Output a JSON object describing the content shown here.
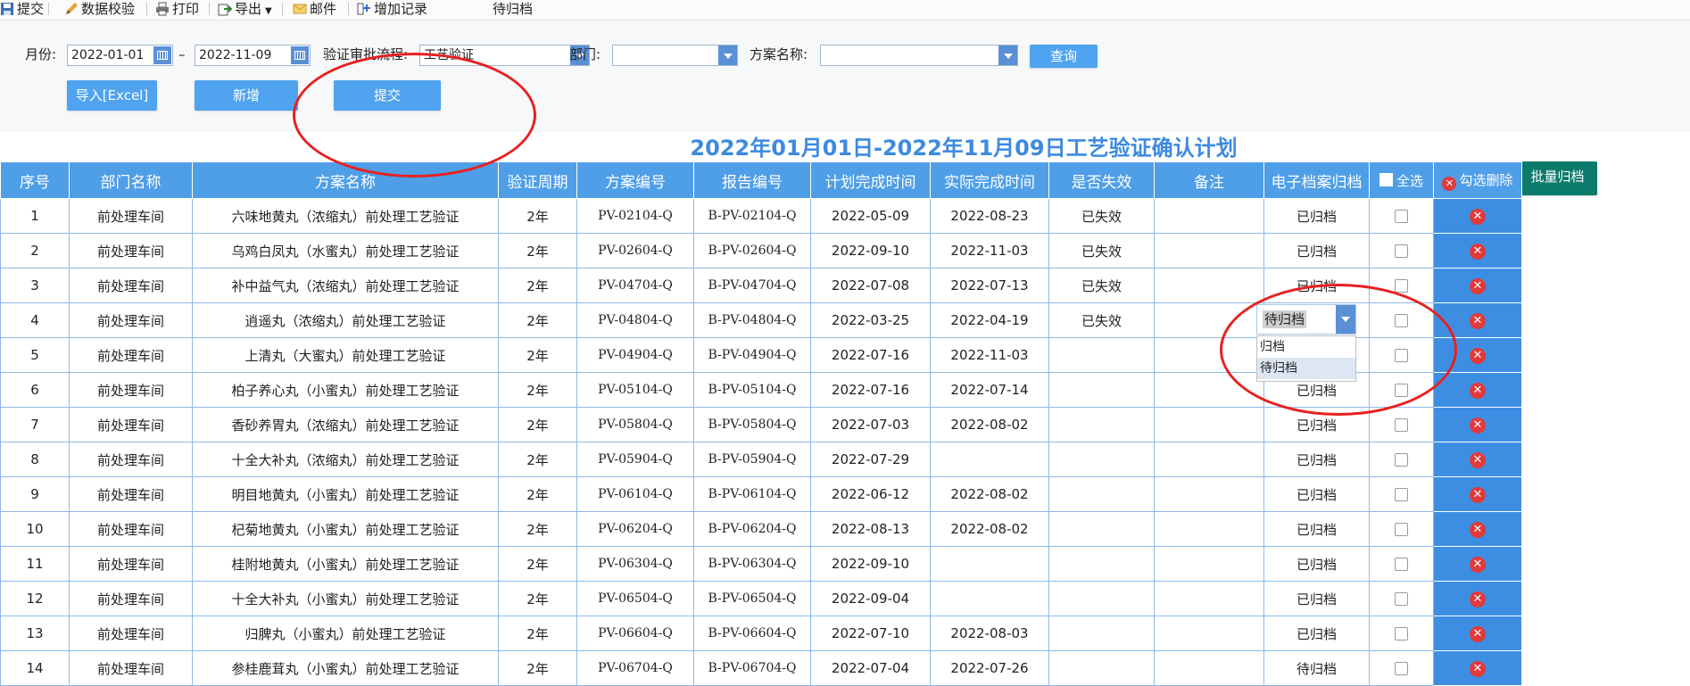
{
  "toolbar": {
    "submit": "提交",
    "verify": "数据校验",
    "print": "打印",
    "export": "导出",
    "mail": "邮件",
    "add_record": "增加记录",
    "status_filter": "待归档"
  },
  "filters": {
    "month_label": "月份:",
    "date_from": "2022-01-01",
    "range_sep": "–",
    "date_to": "2022-11-09",
    "flow_label": "验证审批流程:",
    "flow_value": "工艺验证",
    "dept_label": "部门:",
    "dept_value": "",
    "plan_label": "方案名称:",
    "plan_value": "",
    "query_button": "查询"
  },
  "actions": {
    "import_excel": "导入[Excel]",
    "add_new": "新增",
    "submit": "提交",
    "batch_archive": "批量归档"
  },
  "title": "2022年01月01日-2022年11月09日工艺验证确认计划",
  "table": {
    "headers": [
      "序号",
      "部门名称",
      "方案名称",
      "验证周期",
      "方案编号",
      "报告编号",
      "计划完成时间",
      "实际完成时间",
      "是否失效",
      "备注",
      "电子档案归档",
      "全选",
      "勾选删除"
    ],
    "rows": [
      {
        "no": "1",
        "dept": "前处理车间",
        "plan": "六味地黄丸（浓缩丸）前处理工艺验证",
        "cycle": "2年",
        "plan_no": "PV-02104-Q",
        "report_no": "B-PV-02104-Q",
        "planned": "2022-05-09",
        "actual": "2022-08-23",
        "invalid": "已失效",
        "note": "",
        "archive": "已归档"
      },
      {
        "no": "2",
        "dept": "前处理车间",
        "plan": "乌鸡白凤丸（水蜜丸）前处理工艺验证",
        "cycle": "2年",
        "plan_no": "PV-02604-Q",
        "report_no": "B-PV-02604-Q",
        "planned": "2022-09-10",
        "actual": "2022-11-03",
        "invalid": "已失效",
        "note": "",
        "archive": "已归档"
      },
      {
        "no": "3",
        "dept": "前处理车间",
        "plan": "补中益气丸（浓缩丸）前处理工艺验证",
        "cycle": "2年",
        "plan_no": "PV-04704-Q",
        "report_no": "B-PV-04704-Q",
        "planned": "2022-07-08",
        "actual": "2022-07-13",
        "invalid": "已失效",
        "note": "",
        "archive": "已归档"
      },
      {
        "no": "4",
        "dept": "前处理车间",
        "plan": "逍遥丸（浓缩丸）前处理工艺验证",
        "cycle": "2年",
        "plan_no": "PV-04804-Q",
        "report_no": "B-PV-04804-Q",
        "planned": "2022-03-25",
        "actual": "2022-04-19",
        "invalid": "已失效",
        "note": "",
        "archive": ""
      },
      {
        "no": "5",
        "dept": "前处理车间",
        "plan": "上清丸（大蜜丸）前处理工艺验证",
        "cycle": "2年",
        "plan_no": "PV-04904-Q",
        "report_no": "B-PV-04904-Q",
        "planned": "2022-07-16",
        "actual": "2022-11-03",
        "invalid": "",
        "note": "",
        "archive": ""
      },
      {
        "no": "6",
        "dept": "前处理车间",
        "plan": "柏子养心丸（小蜜丸）前处理工艺验证",
        "cycle": "2年",
        "plan_no": "PV-05104-Q",
        "report_no": "B-PV-05104-Q",
        "planned": "2022-07-16",
        "actual": "2022-07-14",
        "invalid": "",
        "note": "",
        "archive": "已归档"
      },
      {
        "no": "7",
        "dept": "前处理车间",
        "plan": "香砂养胃丸（浓缩丸）前处理工艺验证",
        "cycle": "2年",
        "plan_no": "PV-05804-Q",
        "report_no": "B-PV-05804-Q",
        "planned": "2022-07-03",
        "actual": "2022-08-02",
        "invalid": "",
        "note": "",
        "archive": "已归档"
      },
      {
        "no": "8",
        "dept": "前处理车间",
        "plan": "十全大补丸（浓缩丸）前处理工艺验证",
        "cycle": "2年",
        "plan_no": "PV-05904-Q",
        "report_no": "B-PV-05904-Q",
        "planned": "2022-07-29",
        "actual": "",
        "invalid": "",
        "note": "",
        "archive": "已归档"
      },
      {
        "no": "9",
        "dept": "前处理车间",
        "plan": "明目地黄丸（小蜜丸）前处理工艺验证",
        "cycle": "2年",
        "plan_no": "PV-06104-Q",
        "report_no": "B-PV-06104-Q",
        "planned": "2022-06-12",
        "actual": "2022-08-02",
        "invalid": "",
        "note": "",
        "archive": "已归档"
      },
      {
        "no": "10",
        "dept": "前处理车间",
        "plan": "杞菊地黄丸（小蜜丸）前处理工艺验证",
        "cycle": "2年",
        "plan_no": "PV-06204-Q",
        "report_no": "B-PV-06204-Q",
        "planned": "2022-08-13",
        "actual": "2022-08-02",
        "invalid": "",
        "note": "",
        "archive": "已归档"
      },
      {
        "no": "11",
        "dept": "前处理车间",
        "plan": "桂附地黄丸（小蜜丸）前处理工艺验证",
        "cycle": "2年",
        "plan_no": "PV-06304-Q",
        "report_no": "B-PV-06304-Q",
        "planned": "2022-09-10",
        "actual": "",
        "invalid": "",
        "note": "",
        "archive": "已归档"
      },
      {
        "no": "12",
        "dept": "前处理车间",
        "plan": "十全大补丸（小蜜丸）前处理工艺验证",
        "cycle": "2年",
        "plan_no": "PV-06504-Q",
        "report_no": "B-PV-06504-Q",
        "planned": "2022-09-04",
        "actual": "",
        "invalid": "",
        "note": "",
        "archive": "已归档"
      },
      {
        "no": "13",
        "dept": "前处理车间",
        "plan": "归脾丸（小蜜丸）前处理工艺验证",
        "cycle": "2年",
        "plan_no": "PV-06604-Q",
        "report_no": "B-PV-06604-Q",
        "planned": "2022-07-10",
        "actual": "2022-08-03",
        "invalid": "",
        "note": "",
        "archive": "已归档"
      },
      {
        "no": "14",
        "dept": "前处理车间",
        "plan": "参桂鹿茸丸（小蜜丸）前处理工艺验证",
        "cycle": "2年",
        "plan_no": "PV-06704-Q",
        "report_no": "B-PV-06704-Q",
        "planned": "2022-07-04",
        "actual": "2022-07-26",
        "invalid": "",
        "note": "",
        "archive": "待归档"
      }
    ]
  },
  "archive_combo": {
    "value": "待归档",
    "options": [
      "归档",
      "待归档"
    ],
    "selected_option": "待归档"
  },
  "colors": {
    "header_blue": "#4f9ee8",
    "button_blue": "#4fa3ef",
    "title_blue": "#3d8ae0",
    "batch_button": "#0c7a6a",
    "annotation_red": "#e8201f",
    "delete_red": "#e03a3a"
  },
  "icons": {
    "delete": "close-circle-icon",
    "submit": "save-icon",
    "verify": "pencil-icon",
    "print": "printer-icon",
    "export": "export-icon",
    "mail": "mail-icon",
    "add_record": "add-record-icon",
    "date": "calendar-icon",
    "dropdown": "chevron-down-icon"
  }
}
